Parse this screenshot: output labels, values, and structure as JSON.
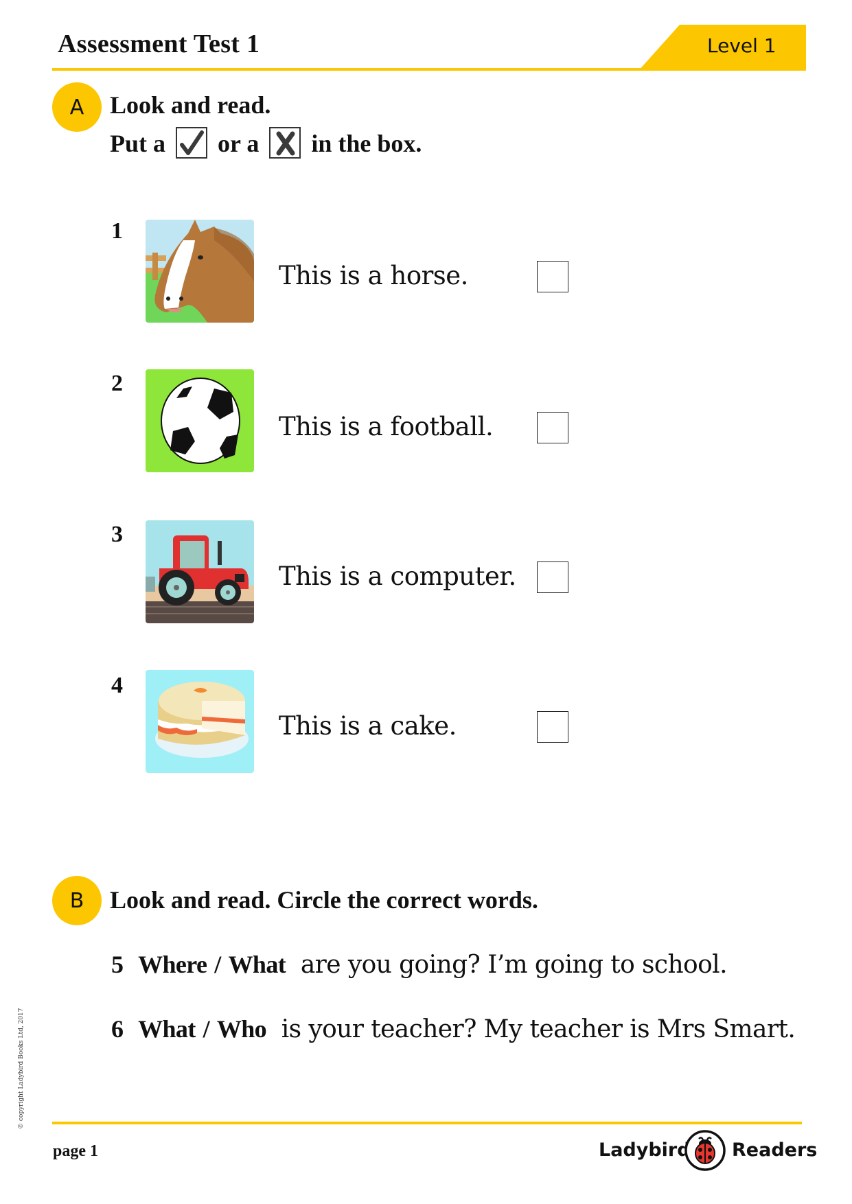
{
  "header": {
    "title": "Assessment Test 1",
    "level_label": "Level 1",
    "accent_color": "#fcc600"
  },
  "section_a": {
    "badge": "A",
    "instruction_line1": "Look and read.",
    "instruction_line2_pre": "Put a",
    "instruction_line2_mid": "or a",
    "instruction_line2_post": "in the box.",
    "tick_icon": "check-mark-icon",
    "cross_icon": "cross-mark-icon",
    "items": [
      {
        "number": "1",
        "picture": "horse",
        "text": "This is a horse.",
        "answer": ""
      },
      {
        "number": "2",
        "picture": "football",
        "text": "This is a football.",
        "answer": ""
      },
      {
        "number": "3",
        "picture": "tractor",
        "text": "This is a computer.",
        "answer": ""
      },
      {
        "number": "4",
        "picture": "cake",
        "text": "This is a cake.",
        "answer": ""
      }
    ]
  },
  "section_b": {
    "badge": "B",
    "instruction": "Look and read. Circle the correct words.",
    "questions": [
      {
        "number": "5",
        "option_a": "Where",
        "separator": "/",
        "option_b": "What",
        "rest": "are you going?  I’m going to school."
      },
      {
        "number": "6",
        "option_a": "What",
        "separator": "/",
        "option_b": "Who",
        "rest": "is your teacher?  My teacher is Mrs Smart."
      }
    ]
  },
  "footer": {
    "page_label": "page 1",
    "brand_left": "Ladybird",
    "brand_right": "Readers",
    "copyright": "© copyright Ladybird Books Ltd, 2017"
  }
}
